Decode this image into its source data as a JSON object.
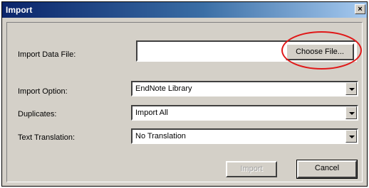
{
  "dialog": {
    "title": "Import",
    "close_label": "×"
  },
  "form": {
    "data_file_label": "Import Data File:",
    "data_file_value": "",
    "choose_file_label": "Choose File...",
    "option_label": "Import Option:",
    "option_value": "EndNote Library",
    "duplicates_label": "Duplicates:",
    "duplicates_value": "Import All",
    "translation_label": "Text Translation:",
    "translation_value": "No Translation"
  },
  "buttons": {
    "import_label": "Import",
    "import_enabled": false,
    "cancel_label": "Cancel"
  },
  "colors": {
    "highlight": "#e01818",
    "title_bar": "#0a246a"
  },
  "icons": {
    "close": "close-icon",
    "dropdown": "chevron-down-icon"
  }
}
